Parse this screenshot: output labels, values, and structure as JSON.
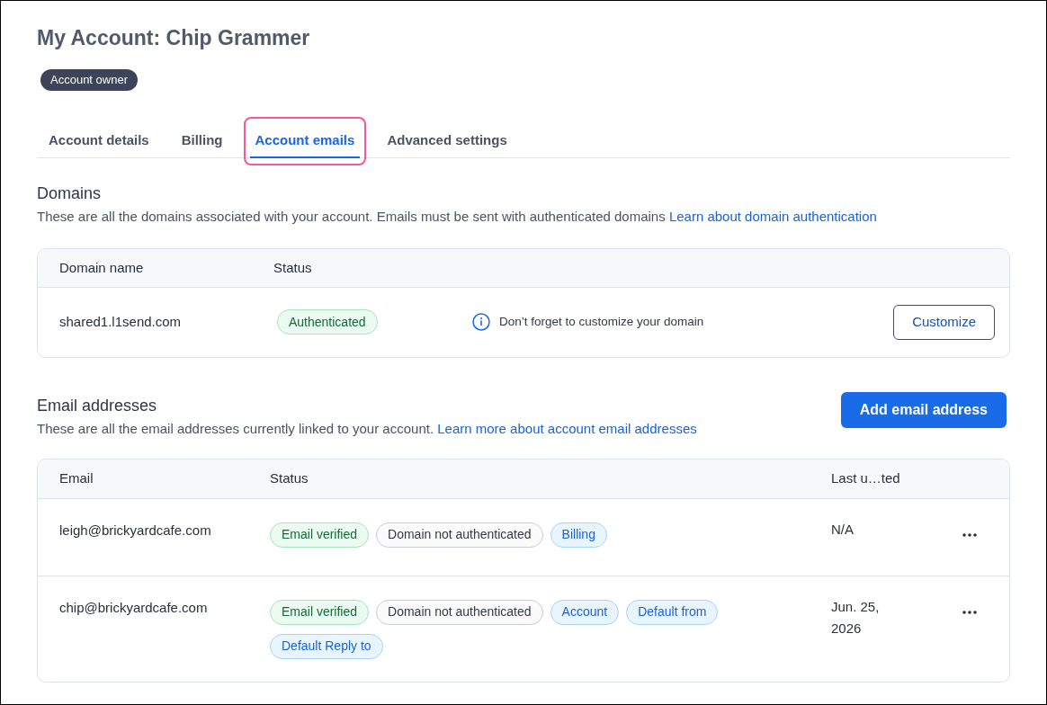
{
  "page": {
    "title": "My Account: Chip Grammer",
    "role_badge": "Account owner"
  },
  "tabs": [
    {
      "label": "Account details",
      "selected": false,
      "highlighted": false
    },
    {
      "label": "Billing",
      "selected": false,
      "highlighted": false
    },
    {
      "label": "Account emails",
      "selected": true,
      "highlighted": true
    },
    {
      "label": "Advanced settings",
      "selected": false,
      "highlighted": false
    }
  ],
  "domains": {
    "heading": "Domains",
    "description": "These are all the domains associated with your account. Emails must be sent with authenticated domains",
    "link": "Learn about domain authentication",
    "table": {
      "columns": [
        "Domain name",
        "Status"
      ],
      "rows": [
        {
          "domain": "shared1.l1send.com",
          "tags": [
            {
              "label": "Authenticated",
              "kind": "success"
            }
          ],
          "notice": "Don’t forget to customize your domain",
          "action": "Customize"
        }
      ]
    }
  },
  "email_addresses": {
    "heading": "Email addresses",
    "description": "These are all the email addresses currently linked to your account.",
    "link": "Learn more about account email addresses",
    "add_button": "Add email address",
    "table": {
      "columns": [
        "Email",
        "Status",
        "Last u…ted"
      ],
      "rows": [
        {
          "email": "leigh@brickyardcafe.com",
          "tags": [
            {
              "label": "Email verified",
              "kind": "success"
            },
            {
              "label": "Domain not authenticated",
              "kind": "neutral"
            },
            {
              "label": "Billing",
              "kind": "info"
            }
          ],
          "last_updated": "N/A"
        },
        {
          "email": "chip@brickyardcafe.com",
          "tags": [
            {
              "label": "Email verified",
              "kind": "success"
            },
            {
              "label": "Domain not authenticated",
              "kind": "neutral"
            },
            {
              "label": "Account",
              "kind": "info"
            },
            {
              "label": "Default from",
              "kind": "info"
            },
            {
              "label": "Default Reply to",
              "kind": "info"
            }
          ],
          "last_updated": "Jun. 25, 2026"
        }
      ]
    }
  }
}
